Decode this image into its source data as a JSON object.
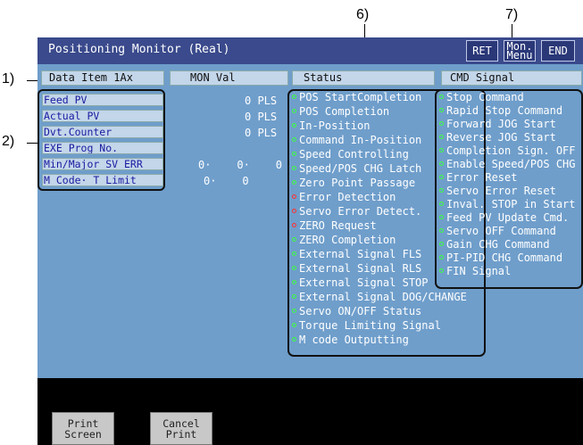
{
  "callouts": [
    "1)",
    "2)",
    "6)",
    "7)"
  ],
  "window": {
    "title": "Positioning Monitor (Real)"
  },
  "title_buttons": {
    "ret": "RET",
    "mon_line1": "Mon.",
    "mon_line2": "Menu",
    "end": "END"
  },
  "headers": {
    "data_item": "Data Item  1Ax",
    "mon_val": "MON Val",
    "status": "Status",
    "cmd_signal": "CMD Signal"
  },
  "items": [
    {
      "label": "Feed PV",
      "value": "0 PLS"
    },
    {
      "label": "Actual PV",
      "value": "0 PLS"
    },
    {
      "label": "Dvt.Counter",
      "value": "0 PLS"
    },
    {
      "label": "EXE Prog No.",
      "value": ""
    },
    {
      "label": "Min/Major SV ERR",
      "value": "0·    0·    0"
    },
    {
      "label": "M Code· T Limit",
      "value": "0·    0"
    }
  ],
  "status": [
    {
      "label": "POS StartCompletion",
      "color": "green"
    },
    {
      "label": "POS Completion",
      "color": "green"
    },
    {
      "label": "In-Position",
      "color": "green"
    },
    {
      "label": "Command In-Position",
      "color": "green"
    },
    {
      "label": "Speed Controlling",
      "color": "green"
    },
    {
      "label": "Speed/POS CHG Latch",
      "color": "green"
    },
    {
      "label": "Zero Point Passage",
      "color": "green"
    },
    {
      "label": "Error Detection",
      "color": "red"
    },
    {
      "label": "Servo Error Detect.",
      "color": "red"
    },
    {
      "label": "ZERO Request",
      "color": "red"
    },
    {
      "label": "ZERO Completion",
      "color": "green"
    },
    {
      "label": "External Signal FLS",
      "color": "green"
    },
    {
      "label": "External Signal RLS",
      "color": "green"
    },
    {
      "label": "External Signal STOP",
      "color": "green"
    },
    {
      "label": "External Signal DOG/CHANGE",
      "color": "green"
    },
    {
      "label": "Servo ON/OFF Status",
      "color": "green"
    },
    {
      "label": "Torque Limiting Signal",
      "color": "green"
    },
    {
      "label": "M code Outputting",
      "color": "green"
    }
  ],
  "cmd_signals": [
    "Stop Command",
    "Rapid Stop Command",
    "Forward JOG Start",
    "Reverse JOG Start",
    "Completion Sign. OFF",
    "Enable Speed/POS CHG",
    "Error Reset",
    "Servo Error Reset",
    "Inval. STOP in Start",
    "Feed PV Update Cmd.",
    "Servo OFF Command",
    "Gain CHG Command",
    "PI-PID CHG Command",
    "FIN Signal"
  ],
  "footer": {
    "print_line1": "Print",
    "print_line2": "Screen",
    "cancel_line1": "Cancel",
    "cancel_line2": "Print"
  },
  "colors": {
    "title_bar": "#3a4a8c",
    "panel_bg": "#6f9ecb",
    "dot_on": "#3dff3d",
    "dot_error": "#ff3030"
  }
}
